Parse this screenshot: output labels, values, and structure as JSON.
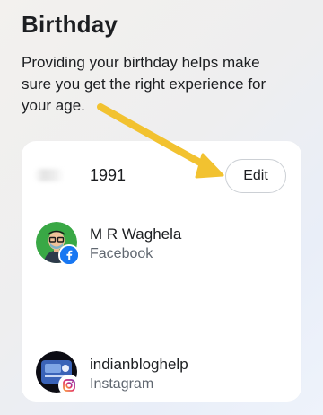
{
  "header": {
    "title": "Birthday",
    "description": "Providing your birthday helps make sure you get the right experience for your age."
  },
  "birthday": {
    "year": "1991",
    "edit_label": "Edit"
  },
  "accounts": [
    {
      "name": "M R Waghela",
      "platform": "Facebook"
    },
    {
      "name": "indianbloghelp",
      "platform": "Instagram"
    }
  ],
  "colors": {
    "annotation_arrow": "#f2c230",
    "facebook_blue": "#1877f2",
    "avatar_green": "#39a845"
  }
}
